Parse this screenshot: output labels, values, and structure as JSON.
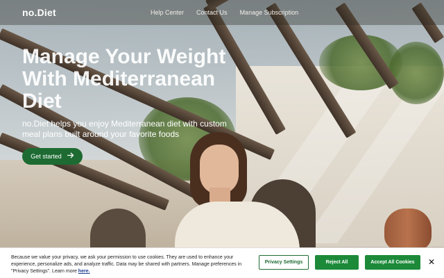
{
  "header": {
    "logo": "no.Diet",
    "nav": [
      "Help Center",
      "Contact Us",
      "Manage Subscription"
    ]
  },
  "hero": {
    "title": "Manage Your Weight With Mediterranean Diet",
    "subtitle": "no.Diet helps you enjoy Mediterranean diet with custom meal plans built around your favorite foods",
    "cta_label": "Get started",
    "cta_icon": "arrow-right-icon"
  },
  "cookie_banner": {
    "text": "Because we value your privacy, we ask your permission to use cookies. They are used to enhance your experience, personalize ads, and analyze traffic. Data may be shared with partners. Manage preferences in \"Privacy Settings\". Learn more",
    "link_text": "here.",
    "settings_label": "Privacy Settings",
    "reject_label": "Reject All",
    "accept_label": "Accept All Cookies",
    "close_label": "✕"
  },
  "colors": {
    "brand_green": "#1d6b32",
    "button_green": "#1d8a3a",
    "link_blue": "#1a3d8f"
  }
}
